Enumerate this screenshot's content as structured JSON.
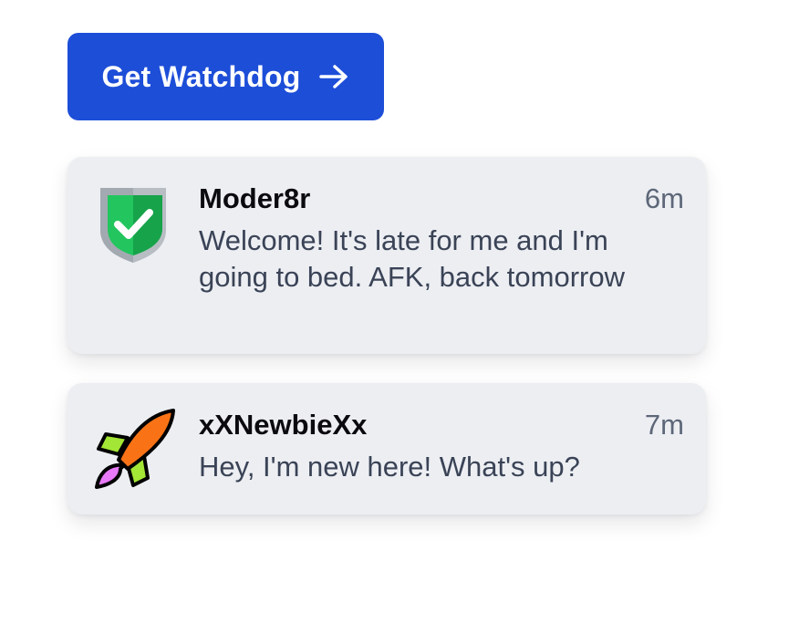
{
  "cta": {
    "label": "Get Watchdog",
    "icon": "arrow-right-icon",
    "color": "#1d4ed8"
  },
  "notifications": [
    {
      "sender": "Moder8r",
      "time": "6m",
      "message": "Welcome! It's late for me and I'm going to bed. AFK, back tomorrow",
      "avatar_icon": "shield-check-icon"
    },
    {
      "sender": "xXNewbieXx",
      "time": "7m",
      "message": "Hey, I'm new here! What's up?",
      "avatar_icon": "rocket-icon"
    }
  ]
}
